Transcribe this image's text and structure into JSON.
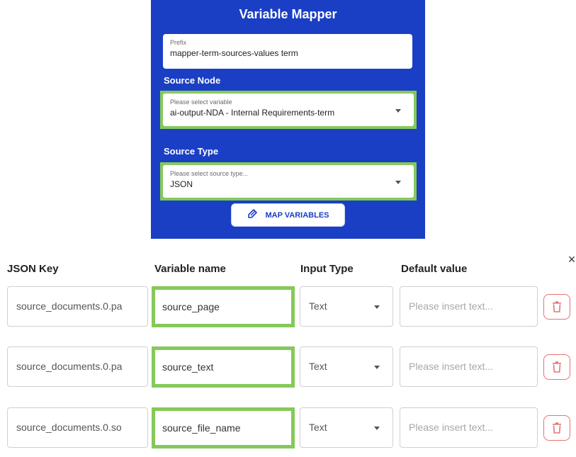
{
  "panel": {
    "title": "Variable Mapper",
    "prefix": {
      "label": "Prefix",
      "value": "mapper-term-sources-values term"
    },
    "source_node": {
      "section_label": "Source Node",
      "placeholder": "Please select variable",
      "value": "ai-output-NDA - Internal Requirements-term"
    },
    "source_type": {
      "section_label": "Source Type",
      "placeholder": "Please select source type...",
      "value": "JSON"
    },
    "map_button_label": "MAP VARIABLES"
  },
  "mapping": {
    "close_symbol": "×",
    "headers": [
      "JSON Key",
      "Variable name",
      "Input Type",
      "Default value"
    ],
    "rows": [
      {
        "json_key": "source_documents.0.pa",
        "variable_name": "source_page",
        "input_type": "Text",
        "default_placeholder": "Please insert text..."
      },
      {
        "json_key": "source_documents.0.pa",
        "variable_name": "source_text",
        "input_type": "Text",
        "default_placeholder": "Please insert text..."
      },
      {
        "json_key": "source_documents.0.so",
        "variable_name": "source_file_name",
        "input_type": "Text",
        "default_placeholder": "Please insert text..."
      }
    ]
  },
  "colors": {
    "panel_bg": "#1a3fc4",
    "highlight": "#86c95a",
    "delete_accent": "#e57373"
  }
}
